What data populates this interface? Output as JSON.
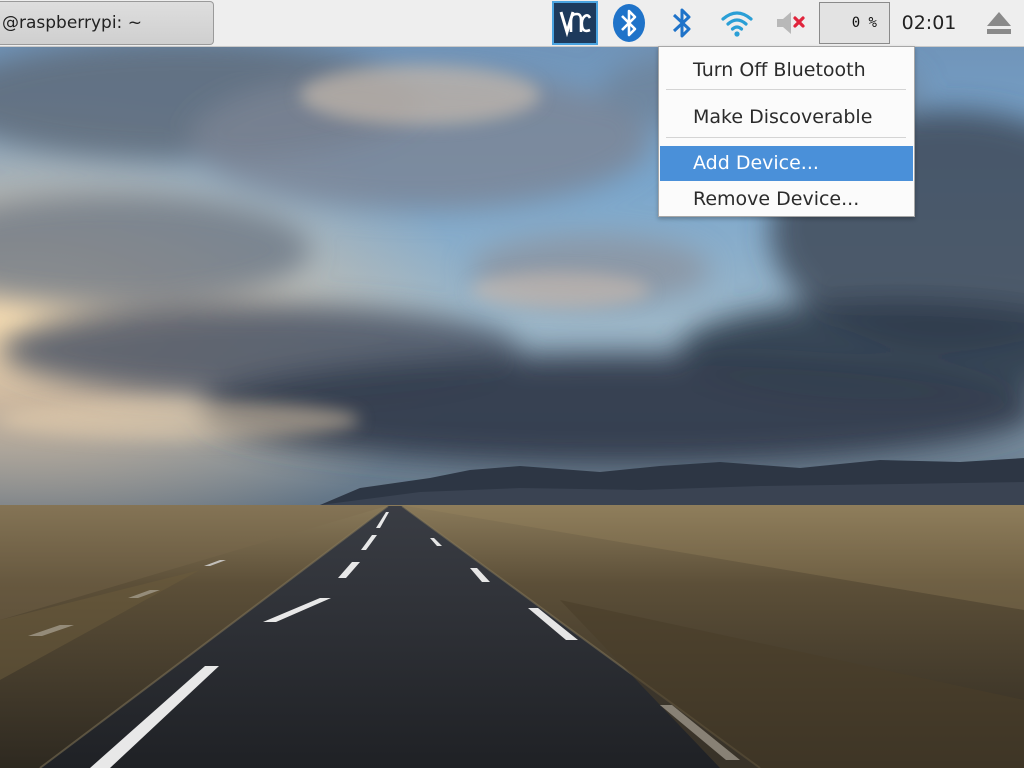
{
  "panel": {
    "taskbar_window_title": "@raspberrypi: ~",
    "cpu_usage": "0 %",
    "clock": "02:01"
  },
  "tray_icons": [
    "vnc-icon",
    "bluetooth-round-icon",
    "bluetooth-icon",
    "wifi-icon",
    "volume-muted-icon",
    "eject-icon"
  ],
  "bluetooth_menu": {
    "items": [
      {
        "label": "Turn Off Bluetooth",
        "selected": false
      },
      {
        "label": "Make Discoverable",
        "selected": false
      },
      {
        "label": "Add Device...",
        "selected": true
      },
      {
        "label": "Remove Device...",
        "selected": false
      }
    ]
  },
  "colors": {
    "panel_bg": "#eeeeee",
    "bluetooth_blue": "#1f73c9",
    "wifi_cyan": "#2a9fd6",
    "menu_highlight": "#4a90d9",
    "vnc_bg": "#1d3a5c",
    "mute_x": "#e0243c"
  }
}
